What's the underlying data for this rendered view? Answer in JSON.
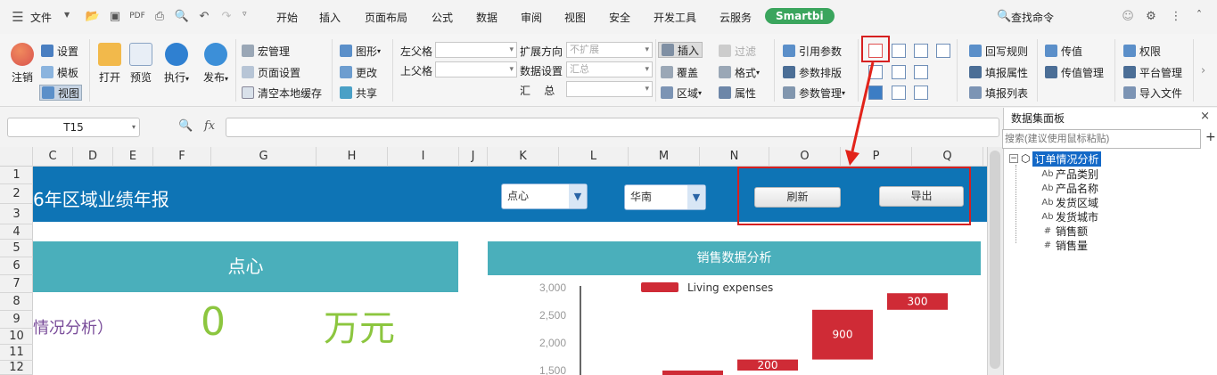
{
  "menubar": {
    "file_label": "文件",
    "tabs": [
      "开始",
      "插入",
      "页面布局",
      "公式",
      "数据",
      "审阅",
      "视图",
      "安全",
      "开发工具",
      "云服务",
      "Smartbi"
    ],
    "search_label": "查找命令"
  },
  "ribbon": {
    "logout": "注销",
    "settings": "设置",
    "template": "模板",
    "view": "视图",
    "open": "打开",
    "preview": "预览",
    "execute": "执行",
    "publish": "发布",
    "macro": "宏管理",
    "page_setup": "页面设置",
    "clear_cache": "清空本地缓存",
    "graphics": "图形",
    "modify": "更改",
    "share": "共享",
    "left_parent": "左父格",
    "top_parent": "上父格",
    "expand_dir": "扩展方向",
    "expand_value": "不扩展",
    "data_setting": "数据设置",
    "data_value": "汇总",
    "summary_label": "汇    总",
    "insert": "插入",
    "overwrite": "覆盖",
    "region": "区域",
    "filter": "过滤",
    "format": "格式",
    "attribute": "属性",
    "ref_param": "引用参数",
    "param_layout": "参数排版",
    "param_manage": "参数管理",
    "writeback_rule": "回写规则",
    "fill_attr": "填报属性",
    "fill_list": "填报列表",
    "pass_value": "传值",
    "pass_value_manage": "传值管理",
    "permission": "权限",
    "platform_manage": "平台管理",
    "import_file": "导入文件"
  },
  "formula_bar": {
    "cell_ref": "T15",
    "fx": "fx"
  },
  "sheet": {
    "columns": [
      "C",
      "D",
      "E",
      "F",
      "G",
      "H",
      "I",
      "J",
      "K",
      "L",
      "M",
      "N",
      "O",
      "P",
      "Q"
    ],
    "rows": [
      "1",
      "2",
      "3",
      "4",
      "5",
      "6",
      "7",
      "8",
      "9",
      "10",
      "11",
      "12"
    ],
    "banner_title": "6年区域业绩年报",
    "dropdown_category": "点心",
    "dropdown_region": "华南",
    "refresh_button": "刷新",
    "export_button": "导出",
    "card_title": "点心",
    "card_subtitle": "情况分析）",
    "card_value": "0",
    "card_unit": "万元",
    "chart_title": "销售数据分析"
  },
  "chart_data": {
    "type": "bar",
    "legend": "Living expenses",
    "yticks": [
      "3,000",
      "2,500",
      "2,000",
      "1,500"
    ],
    "ylim": [
      1400,
      3000
    ],
    "bars": [
      {
        "base": 1400,
        "top": 1500,
        "label": ""
      },
      {
        "base": 1500,
        "top": 1700,
        "label": "200"
      },
      {
        "base": 1700,
        "top": 2600,
        "label": "900"
      },
      {
        "base": 2600,
        "top": 2900,
        "label": "300"
      }
    ],
    "bar_color": "#cf2b36"
  },
  "panel": {
    "title": "数据集面板",
    "close": "×",
    "search_placeholder": "搜索(建议使用鼠标粘贴)",
    "plus": "+",
    "tree_root": "订单情况分析",
    "fields": [
      {
        "icon": "Ab",
        "label": "产品类别"
      },
      {
        "icon": "Ab",
        "label": "产品名称"
      },
      {
        "icon": "Ab",
        "label": "发货区域"
      },
      {
        "icon": "Ab",
        "label": "发货城市"
      },
      {
        "icon": "#",
        "label": "销售额"
      },
      {
        "icon": "#",
        "label": "销售量"
      }
    ]
  }
}
